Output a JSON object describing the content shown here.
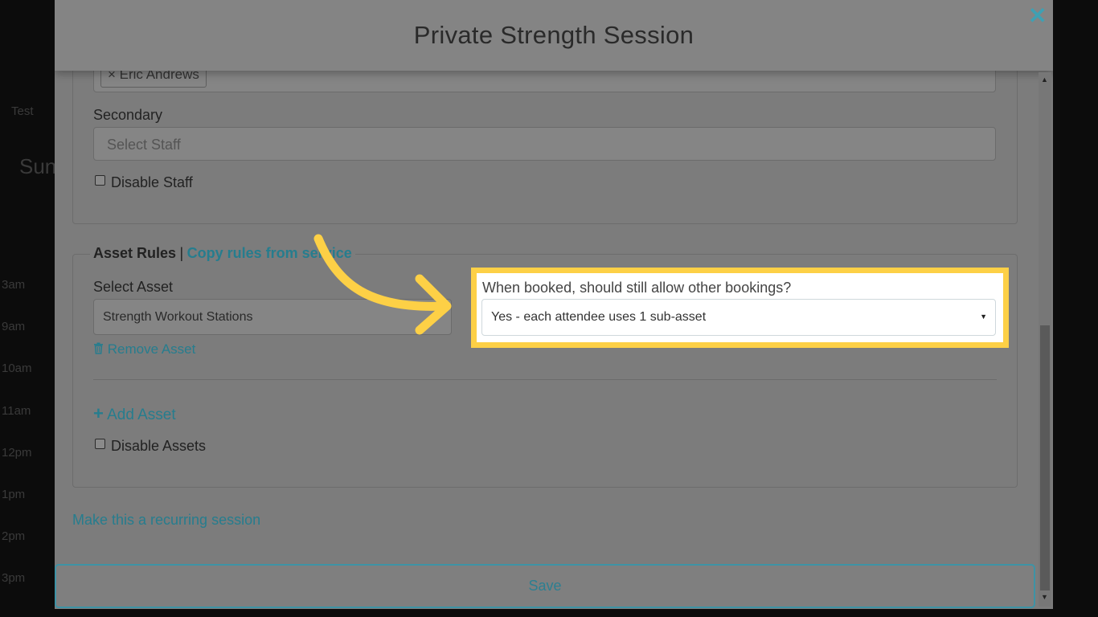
{
  "background": {
    "snippets": [
      "Test",
      "Sun",
      "3am",
      "9am",
      "10am",
      "11am",
      "12pm",
      "1pm",
      "2pm",
      "3pm"
    ]
  },
  "modal": {
    "title": "Private Strength Session",
    "staff": {
      "primary_tag": "× Eric Andrews",
      "secondary_label": "Secondary",
      "secondary_placeholder": "Select Staff",
      "disable_label": "Disable Staff"
    },
    "assets": {
      "heading": "Asset Rules",
      "separator": "|",
      "copy_link": "Copy rules from service",
      "select_label": "Select Asset",
      "select_value": "Strength Workout Stations",
      "remove_link": "Remove Asset",
      "booking_question": "When booked, should still allow other bookings?",
      "booking_value": "Yes - each attendee uses 1 sub-asset",
      "add_link": "Add Asset",
      "disable_label": "Disable Assets"
    },
    "recurring_link": "Make this a recurring session",
    "save_label": "Save"
  },
  "colors": {
    "highlight": "#fdd046",
    "link": "#267d8e",
    "accent": "#3fa0b3"
  },
  "icons": [
    "close-icon",
    "trash-icon",
    "plus-icon",
    "caret-down-icon",
    "arrow-annotation-icon"
  ]
}
